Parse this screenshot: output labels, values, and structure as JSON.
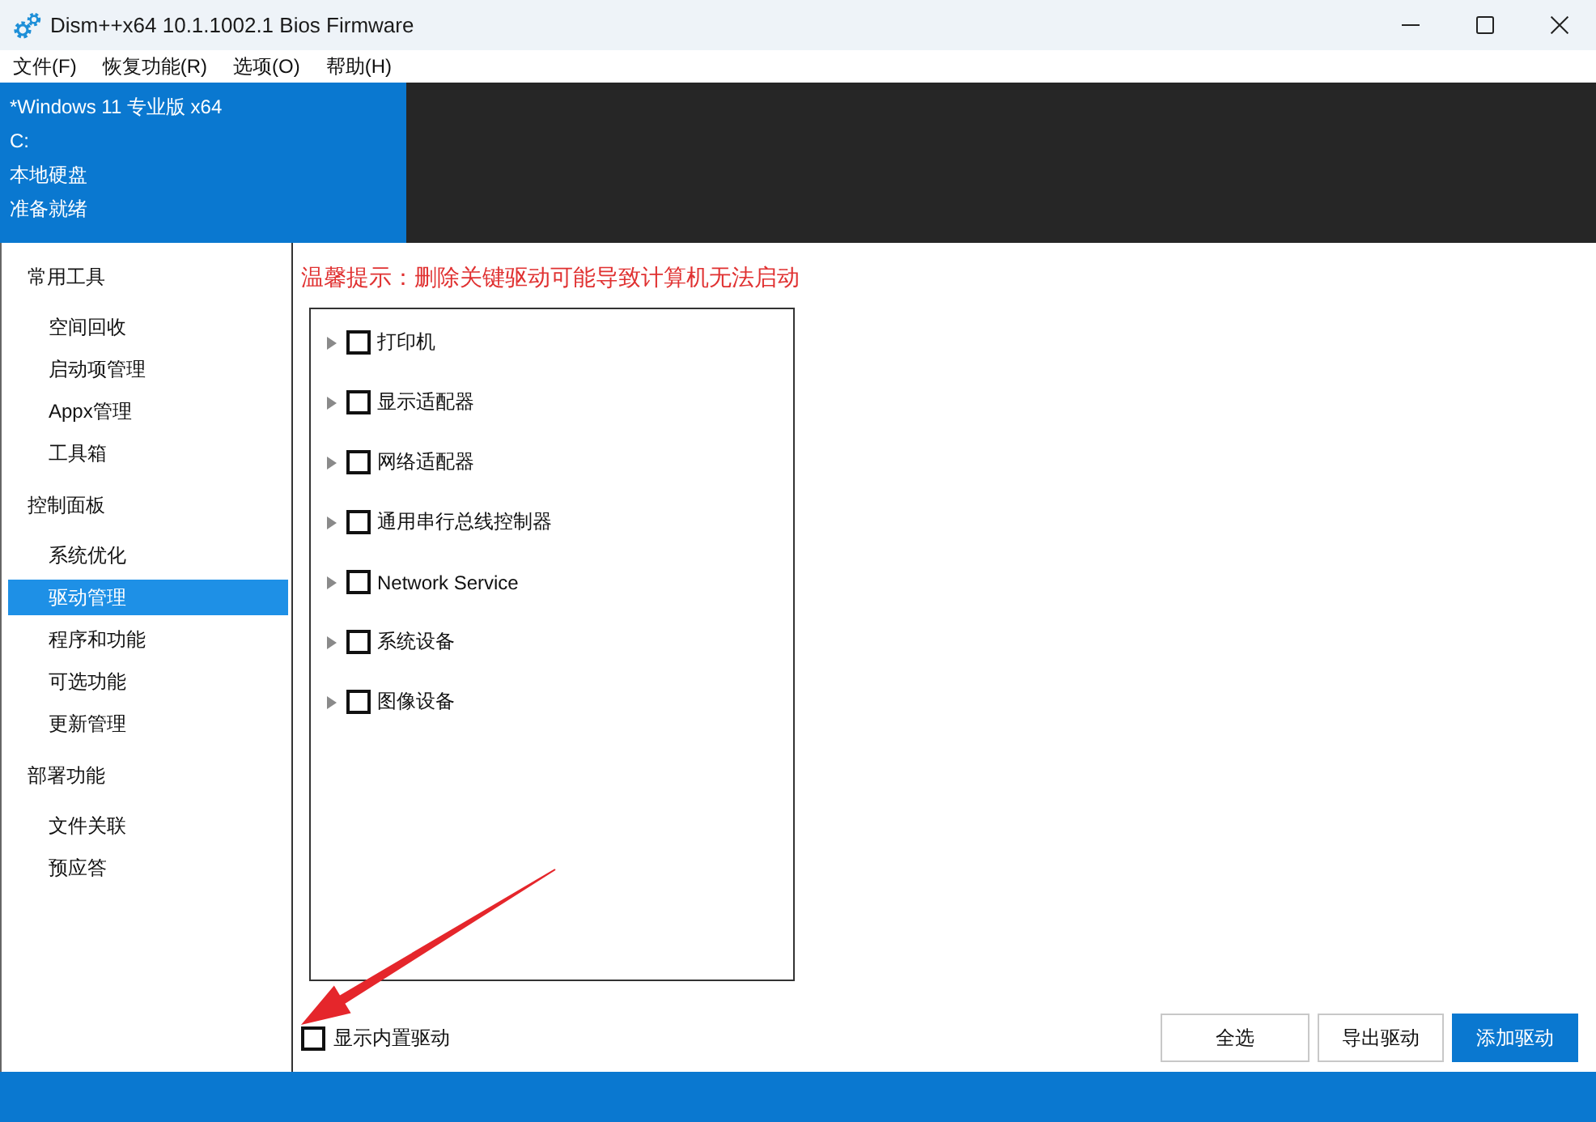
{
  "window": {
    "title": "Dism++x64 10.1.1002.1 Bios Firmware"
  },
  "menu": [
    "文件(F)",
    "恢复功能(R)",
    "选项(O)",
    "帮助(H)"
  ],
  "image_info": [
    "*Windows 11 专业版 x64",
    "C:",
    "本地硬盘",
    "准备就绪"
  ],
  "sidebar": {
    "groups": [
      {
        "label": "常用工具",
        "items": [
          {
            "label": "空间回收",
            "selected": false
          },
          {
            "label": "启动项管理",
            "selected": false
          },
          {
            "label": "Appx管理",
            "selected": false
          },
          {
            "label": "工具箱",
            "selected": false
          }
        ]
      },
      {
        "label": "控制面板",
        "items": [
          {
            "label": "系统优化",
            "selected": false
          },
          {
            "label": "驱动管理",
            "selected": true
          },
          {
            "label": "程序和功能",
            "selected": false
          },
          {
            "label": "可选功能",
            "selected": false
          },
          {
            "label": "更新管理",
            "selected": false
          }
        ]
      },
      {
        "label": "部署功能",
        "items": [
          {
            "label": "文件关联",
            "selected": false
          },
          {
            "label": "预应答",
            "selected": false
          }
        ]
      }
    ]
  },
  "warning": "温馨提示：删除关键驱动可能导致计算机无法启动",
  "driver_tree": [
    {
      "label": "打印机",
      "checked": false,
      "expanded": false
    },
    {
      "label": "显示适配器",
      "checked": false,
      "expanded": false
    },
    {
      "label": "网络适配器",
      "checked": false,
      "expanded": false
    },
    {
      "label": "通用串行总线控制器",
      "checked": false,
      "expanded": false
    },
    {
      "label": "Network Service",
      "checked": false,
      "expanded": false
    },
    {
      "label": "系统设备",
      "checked": false,
      "expanded": false
    },
    {
      "label": "图像设备",
      "checked": false,
      "expanded": false
    }
  ],
  "show_builtin": {
    "label": "显示内置驱动",
    "checked": false
  },
  "buttons": [
    {
      "label": "全选",
      "kind": "default"
    },
    {
      "label": "导出驱动",
      "kind": "default"
    },
    {
      "label": "添加驱动",
      "kind": "primary"
    }
  ]
}
